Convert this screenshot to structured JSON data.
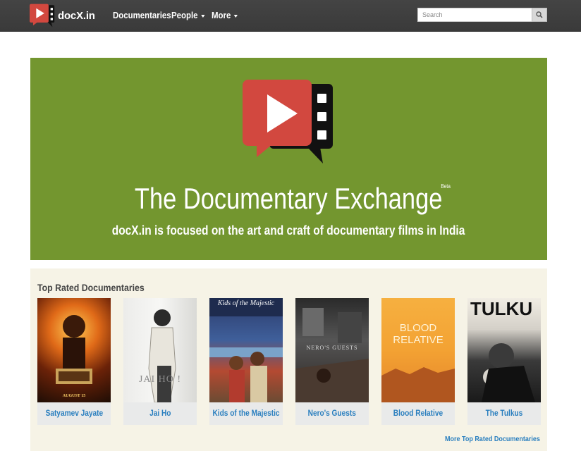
{
  "brand": {
    "name": "docX.in"
  },
  "nav": {
    "items": [
      {
        "label": "Documentaries",
        "dropdown": false
      },
      {
        "label": "People",
        "dropdown": true
      },
      {
        "label": "More",
        "dropdown": true
      }
    ]
  },
  "search": {
    "placeholder": "Search"
  },
  "hero": {
    "title": "The Documentary Exchange",
    "badge": "Beta",
    "subtitle": "docX.in is focused on the art and craft of documentary films in India"
  },
  "top_rated": {
    "heading": "Top Rated Documentaries",
    "items": [
      {
        "title": "Satyamev Jayate",
        "poster_text": "AUGUST 15"
      },
      {
        "title": "Jai Ho",
        "poster_text": "JAI HO !"
      },
      {
        "title": "Kids of the Majestic",
        "poster_text": "Kids of the Majestic"
      },
      {
        "title": "Nero's Guests",
        "poster_text": "NERO'S GUESTS"
      },
      {
        "title": "Blood Relative",
        "poster_text": "BLOOD RELATIVE"
      },
      {
        "title": "The Tulkus",
        "poster_text": "TULKU"
      }
    ],
    "more_link": "More Top Rated Documentaries"
  },
  "colors": {
    "navbar": "#3f3f3f",
    "hero_bg": "#73962f",
    "logo_red": "#d2483f",
    "section_bg": "#f6f3e6",
    "link": "#2a7fbf"
  },
  "icons": {
    "brand": "play-filmstrip-logo",
    "search": "magnifier-icon"
  }
}
